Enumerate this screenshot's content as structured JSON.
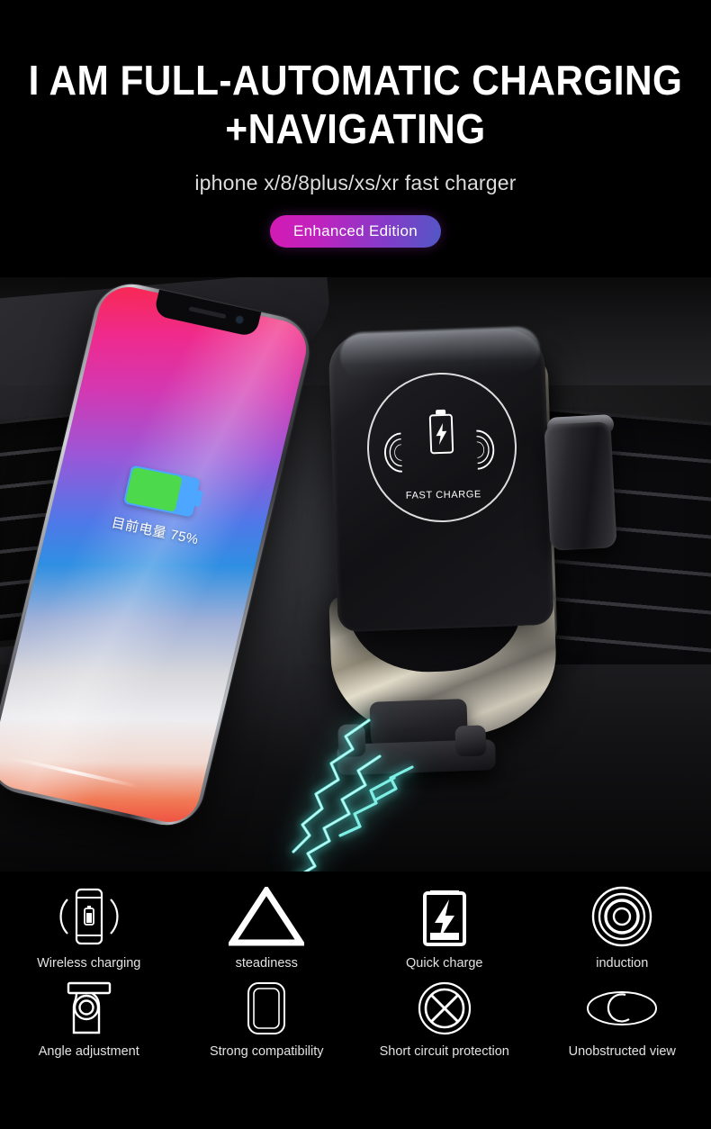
{
  "header": {
    "title_line1": "I AM FULL-AUTOMATIC CHARGING",
    "title_line2": "+NAVIGATING",
    "subtitle": "iphone x/8/8plus/xs/xr fast charger",
    "badge_label": "Enhanced Edition",
    "badge_gradient_from": "#d41ab4",
    "badge_gradient_to": "#5157c6",
    "title_color": "#ffffff",
    "subtitle_color": "#dcdcdc",
    "background_color": "#000000"
  },
  "product_photo": {
    "scene": "car-dashboard-air-vent",
    "phone": {
      "battery_percent_text": "目前电量 75%",
      "battery_fill_color": "#4cd94c",
      "battery_shell_color": "#4da6ff",
      "wallpaper": "pink-blue-gradient"
    },
    "charger": {
      "logo_text": "FAST CHARGE",
      "logo_icon": "battery-bolt-waves",
      "body_color": "#17171a",
      "chrome_color": "#cfc9b8"
    },
    "effects": {
      "arc_color": "#5fe0d8",
      "arc_label": "electric-arc"
    }
  },
  "features": {
    "row1": [
      {
        "icon": "wireless-charging-icon",
        "label": "Wireless charging"
      },
      {
        "icon": "triangle-steadiness-icon",
        "label": "steadiness"
      },
      {
        "icon": "battery-bolt-icon",
        "label": "Quick charge"
      },
      {
        "icon": "concentric-circles-induction-icon",
        "label": "induction"
      }
    ],
    "row2": [
      {
        "icon": "angle-adjustment-icon",
        "label": "Angle adjustment"
      },
      {
        "icon": "phone-outline-compatibility-icon",
        "label": "Strong compatibility"
      },
      {
        "icon": "circle-x-short-circuit-icon",
        "label": "Short circuit protection"
      },
      {
        "icon": "ellipse-crescent-view-icon",
        "label": "Unobstructed view"
      }
    ],
    "icon_color": "#ffffff",
    "label_color": "#e2e2e2"
  }
}
